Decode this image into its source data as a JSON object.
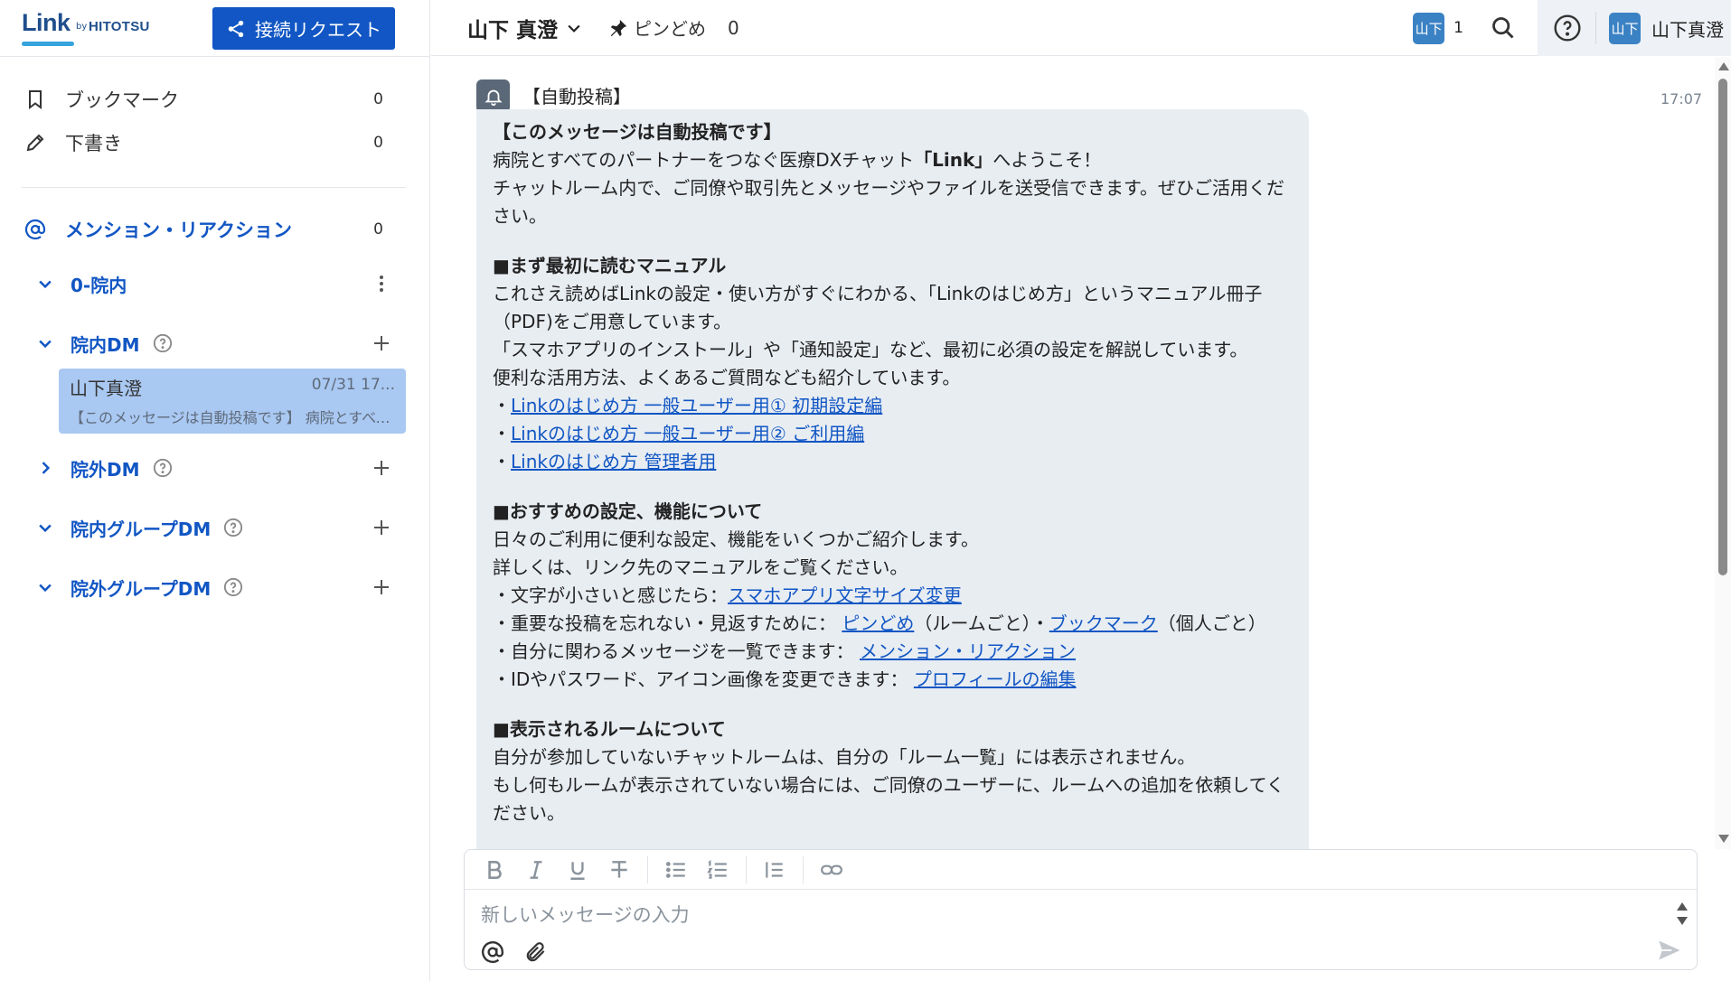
{
  "brand": {
    "logo": "Link",
    "by": "by",
    "company": "HITOTSU"
  },
  "connect_button": {
    "label": "接続リクエスト",
    "icon": "share-icon"
  },
  "sidebar": {
    "bookmark": {
      "label": "ブックマーク",
      "count": "0",
      "icon": "bookmark-icon"
    },
    "draft": {
      "label": "下書き",
      "count": "0",
      "icon": "pencil-icon"
    },
    "mention": {
      "label": "メンション・リアクション",
      "count": "0",
      "icon": "at-icon"
    },
    "sections": [
      {
        "title": "0-院内",
        "expanded": true
      },
      {
        "title": "院内DM",
        "expanded": true
      },
      {
        "title": "院外DM",
        "expanded": false
      },
      {
        "title": "院内グループDM",
        "expanded": true
      },
      {
        "title": "院外グループDM",
        "expanded": true
      }
    ],
    "dm_item": {
      "name": "山下真澄",
      "time": "07/31 17...",
      "preview": "【このメッセージは自動投稿です】 病院とすべてのパートナーをつなぐ医療DXチャット"
    }
  },
  "header": {
    "room_title": "山下 真澄",
    "pin_label": "ピンどめ",
    "pin_count": "0",
    "member_avatar": "山下",
    "member_count": "1",
    "user_avatar": "山下",
    "user_name": "山下真澄"
  },
  "message": {
    "sender": "【自動投稿】",
    "time": "17:07",
    "lines": {
      "l1": "【このメッセージは自動投稿です】",
      "l2a": "病院とすべてのパートナーをつなぐ医療DXチャット",
      "l2b": "「Link」",
      "l2c": "へようこそ！",
      "l3": "チャットルーム内で、ご同僚や取引先とメッセージやファイルを送受信できます。ぜひご活用ください。",
      "h1": "■まず最初に読むマニュアル",
      "p1": "これさえ読めばLinkの設定・使い方がすぐにわかる、「Linkのはじめ方」というマニュアル冊子（PDF)をご用意しています。",
      "p2": "「スマホアプリのインストール」や「通知設定」など、最初に必須の設定を解説しています。",
      "p3": "便利な活用方法、よくあるご質問なども紹介しています。",
      "bullet": "・",
      "link1": "Linkのはじめ方 一般ユーザー用① 初期設定編",
      "link2": "Linkのはじめ方 一般ユーザー用② ご利用編",
      "link3": "Linkのはじめ方 管理者用",
      "h2": "■おすすめの設定、機能について",
      "p4": "日々のご利用に便利な設定、機能をいくつかご紹介します。",
      "p5": "詳しくは、リンク先のマニュアルをご覧ください。",
      "p6": "・文字が小さいと感じたら：",
      "link4": "スマホアプリ文字サイズ変更",
      "p7a": "・重要な投稿を忘れない・見返すために： ",
      "link5": "ピンどめ",
      "p7b": "（ルームごと）・",
      "link6": "ブックマーク",
      "p7c": "（個人ごと）",
      "p8": "・自分に関わるメッセージを一覧できます： ",
      "link7": "メンション・リアクション",
      "p9": "・IDやパスワード、アイコン画像を変更できます： ",
      "link8": "プロフィールの編集",
      "h3": "■表示されるルームについて",
      "p10": "自分が参加していないチャットルームは、自分の「ルーム一覧」には表示されません。",
      "p11": "もし何もルームが表示されていない場合には、ご同僚のユーザーに、ルームへの追加を依頼してください。"
    }
  },
  "composer": {
    "placeholder": "新しいメッセージの入力",
    "tools": [
      "bold-icon",
      "italic-icon",
      "underline-icon",
      "strikethrough-icon",
      "bullet-list-icon",
      "numbered-list-icon",
      "blockquote-icon",
      "link-icon"
    ]
  },
  "colors": {
    "accent": "#1156c4",
    "selected": "#a9c8f2",
    "bubble": "#e8edf2",
    "avatar": "#3b82c4"
  }
}
